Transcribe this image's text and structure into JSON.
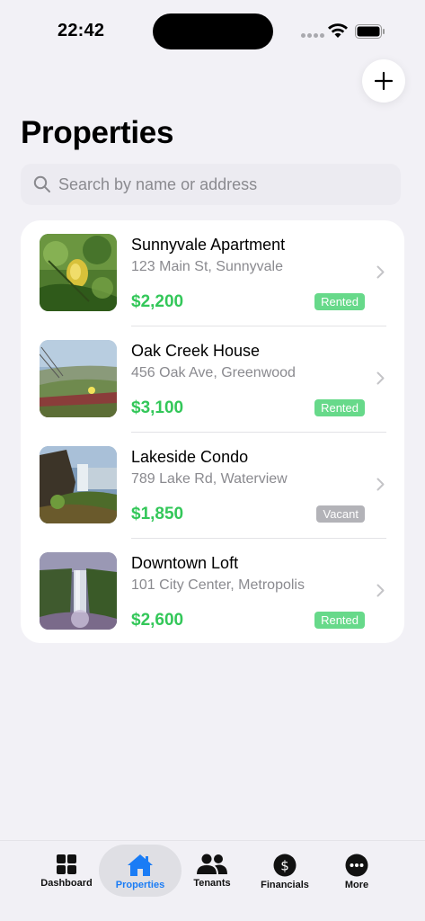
{
  "status_bar": {
    "time": "22:42"
  },
  "header": {
    "title": "Properties"
  },
  "search": {
    "placeholder": "Search by name or address"
  },
  "properties": [
    {
      "name": "Sunnyvale Apartment",
      "address": "123 Main St, Sunnyvale",
      "price": "$2,200",
      "status": "Rented"
    },
    {
      "name": "Oak Creek House",
      "address": "456 Oak Ave, Greenwood",
      "price": "$3,100",
      "status": "Rented"
    },
    {
      "name": "Lakeside Condo",
      "address": "789 Lake Rd, Waterview",
      "price": "$1,850",
      "status": "Vacant"
    },
    {
      "name": "Downtown Loft",
      "address": "101 City Center, Metropolis",
      "price": "$2,600",
      "status": "Rented"
    }
  ],
  "tabs": [
    {
      "label": "Dashboard",
      "icon": "grid-icon",
      "active": false
    },
    {
      "label": "Properties",
      "icon": "house-icon",
      "active": true
    },
    {
      "label": "Tenants",
      "icon": "people-icon",
      "active": false
    },
    {
      "label": "Financials",
      "icon": "dollar-circle-icon",
      "active": false
    },
    {
      "label": "More",
      "icon": "ellipsis-circle-icon",
      "active": false
    }
  ],
  "colors": {
    "accent": "#1a7cf5",
    "price": "#33c759",
    "rented": "#67d98a",
    "vacant": "#b3b3b8"
  }
}
